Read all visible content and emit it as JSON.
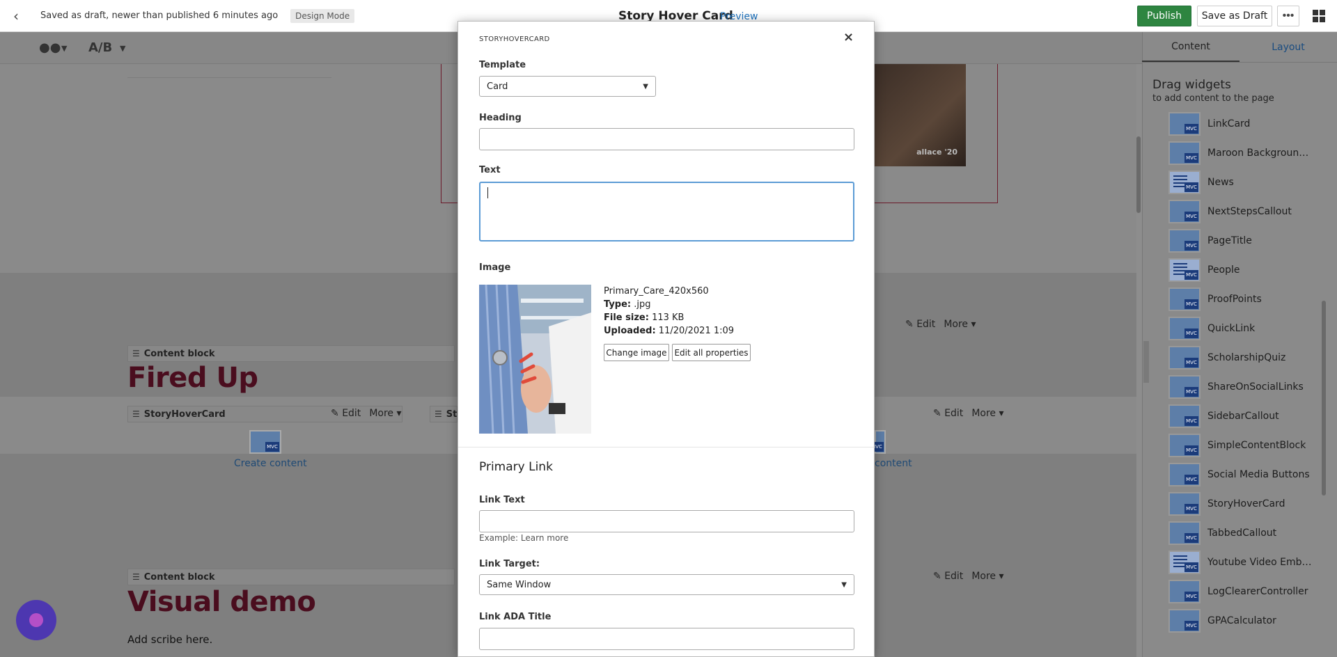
{
  "topbar": {
    "draft_status": "Saved as draft, newer than published 6 minutes ago",
    "mode_badge": "Design Mode",
    "page_title": "Story Hover Card",
    "preview": "Preview",
    "publish": "Publish",
    "save_draft": "Save as Draft",
    "more": "•••"
  },
  "subbar": {
    "ab": "A/B"
  },
  "canvas": {
    "photo_caption": "allace '20",
    "block1": {
      "header": "Content block",
      "heading": "Fired Up"
    },
    "hover_card_left": {
      "header": "StoryHoverCard",
      "create": "Create content"
    },
    "hover_card_mid": {
      "header": "Sto"
    },
    "hover_card_right": {
      "create": "content"
    },
    "block2": {
      "header": "Content block",
      "heading": "Visual demo",
      "body": "Add scribe here."
    },
    "edit": "Edit",
    "more": "More"
  },
  "sidebar": {
    "tabs": [
      "Content",
      "Layout"
    ],
    "drag_title": "Drag widgets",
    "drag_sub": "to add content to the page",
    "widgets": [
      {
        "label": "LinkCard",
        "kind": "mvc"
      },
      {
        "label": "Maroon Background ...",
        "kind": "mvc"
      },
      {
        "label": "News",
        "kind": "list"
      },
      {
        "label": "NextStepsCallout",
        "kind": "mvc"
      },
      {
        "label": "PageTitle",
        "kind": "mvc"
      },
      {
        "label": "People",
        "kind": "list"
      },
      {
        "label": "ProofPoints",
        "kind": "mvc"
      },
      {
        "label": "QuickLink",
        "kind": "mvc"
      },
      {
        "label": "ScholarshipQuiz",
        "kind": "mvc"
      },
      {
        "label": "ShareOnSocialLinks",
        "kind": "mvc"
      },
      {
        "label": "SidebarCallout",
        "kind": "mvc"
      },
      {
        "label": "SimpleContentBlock",
        "kind": "mvc"
      },
      {
        "label": "Social Media Buttons",
        "kind": "mvc"
      },
      {
        "label": "StoryHoverCard",
        "kind": "mvc"
      },
      {
        "label": "TabbedCallout",
        "kind": "mvc"
      },
      {
        "label": "Youtube Video Embed",
        "kind": "list"
      },
      {
        "label": "LogClearerController",
        "kind": "mvc"
      },
      {
        "label": "GPACalculator",
        "kind": "mvc"
      }
    ]
  },
  "modal": {
    "type": "STORYHOVERCARD",
    "close": "×",
    "template_label": "Template",
    "template_value": "Card",
    "heading_label": "Heading",
    "heading_value": "",
    "text_label": "Text",
    "text_value": "",
    "image_label": "Image",
    "image": {
      "name": "Primary_Care_420x560",
      "type_label": "Type:",
      "type_value": ".jpg",
      "size_label": "File size:",
      "size_value": "113 KB",
      "uploaded_label": "Uploaded:",
      "uploaded_value": "11/20/2021 1:09"
    },
    "change_image": "Change image",
    "edit_all": "Edit all properties",
    "primary_link_title": "Primary Link",
    "link_text_label": "Link Text",
    "link_text_value": "",
    "link_text_hint": "Example: Learn more",
    "link_target_label": "Link Target:",
    "link_target_value": "Same Window",
    "link_ada_label": "Link ADA Title",
    "link_ada_value": ""
  }
}
